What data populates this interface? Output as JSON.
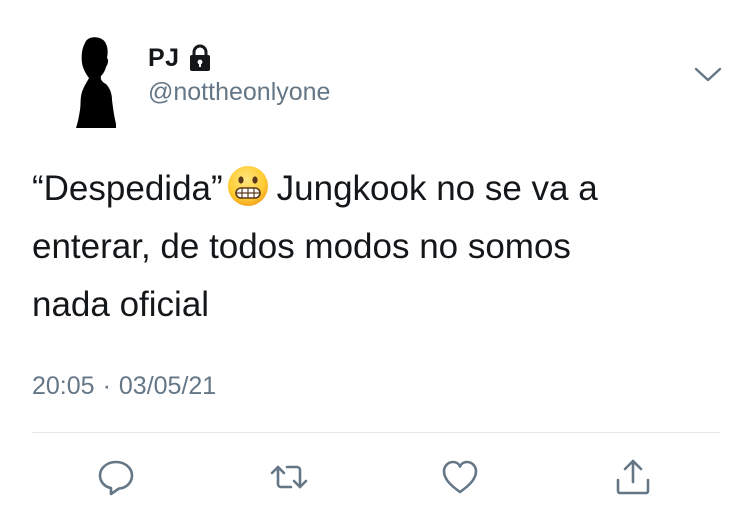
{
  "user": {
    "display_name": "PJ",
    "handle": "@nottheonlyone",
    "protected_icon": "lock-icon",
    "avatar": "silhouette-avatar"
  },
  "tweet": {
    "lines": [
      {
        "before": "“Despedida”",
        "emoji": "grimacing-face-emoji",
        "after": "Jungkook no se va a"
      },
      {
        "text": "enterar, de todos modos no somos"
      },
      {
        "text": "nada oficial"
      }
    ],
    "time": "20:05",
    "separator": "·",
    "date": "03/05/21"
  },
  "actions": {
    "reply_icon": "reply-icon",
    "retweet_icon": "retweet-icon",
    "like_icon": "heart-icon",
    "share_icon": "share-icon",
    "more_icon": "chevron-down-icon"
  },
  "colors": {
    "text": "#14171a",
    "secondary": "#657786",
    "divider": "#e1e8ed",
    "icon": "#657786"
  }
}
